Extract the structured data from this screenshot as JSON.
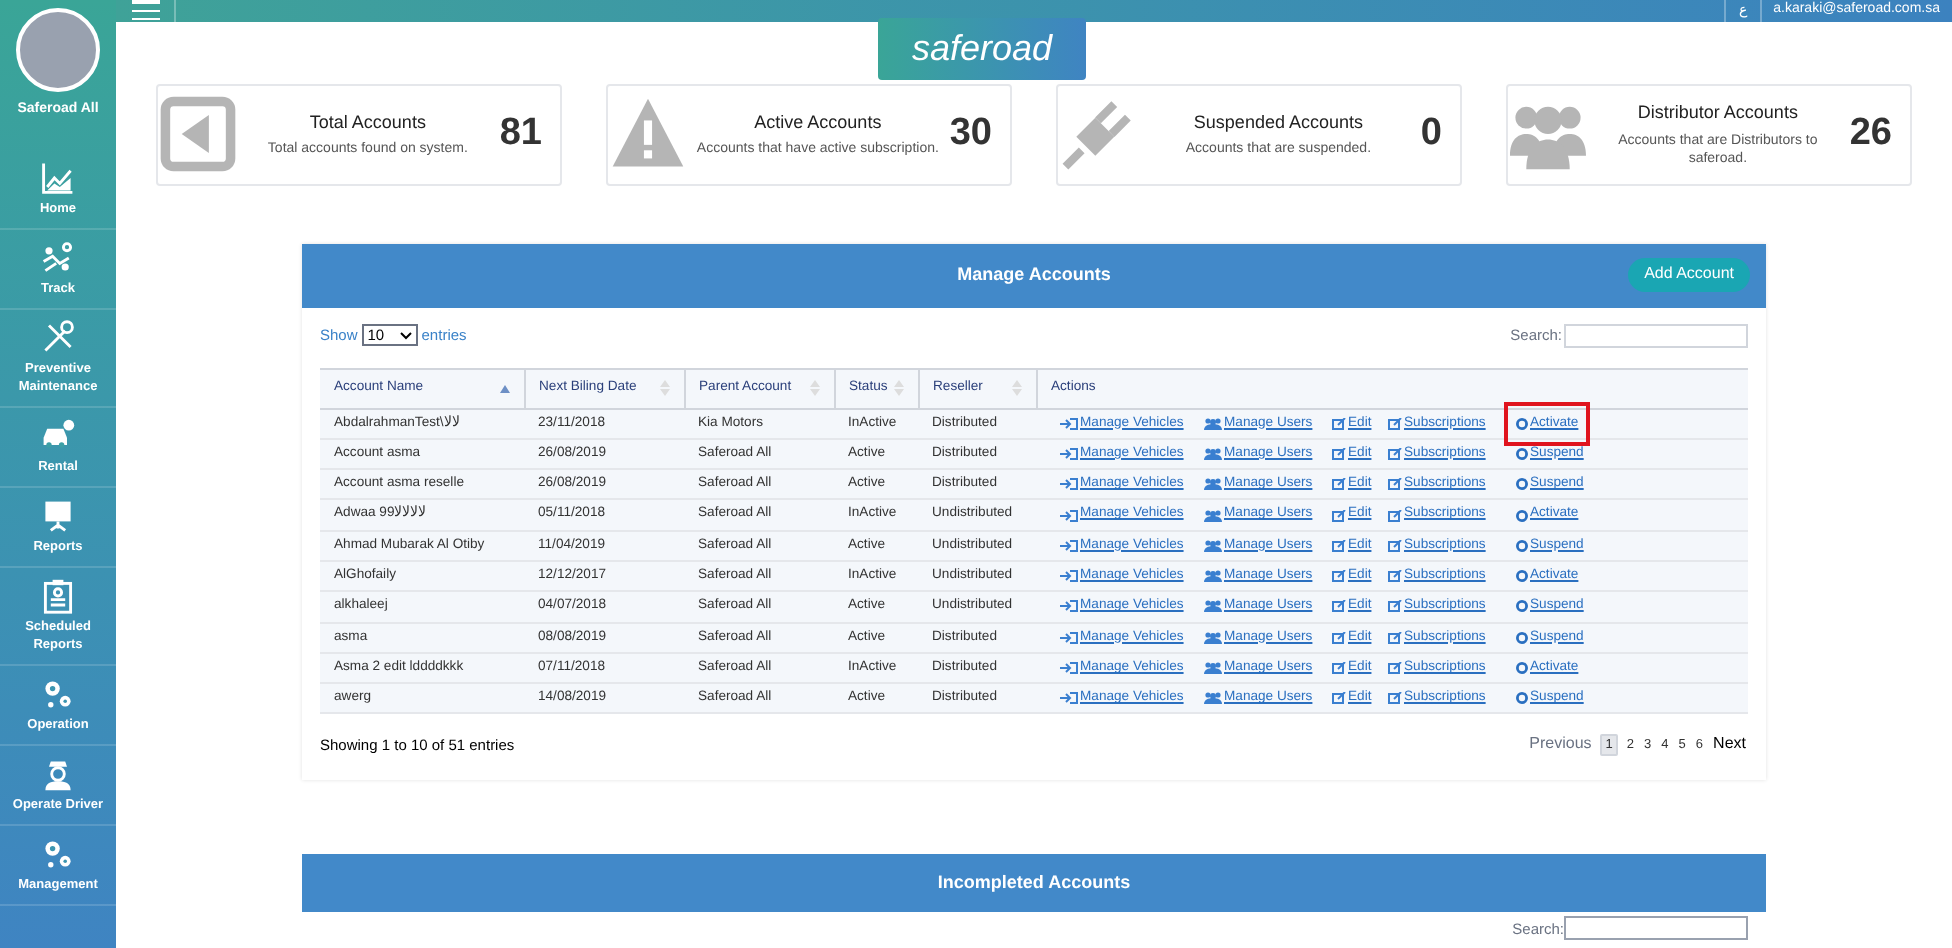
{
  "sidebar": {
    "user": "Saferoad All",
    "items": [
      {
        "label": "Home",
        "kind": "chart"
      },
      {
        "label": "Track",
        "kind": "track"
      },
      {
        "label": "Preventive Maintenance",
        "kind": "tools"
      },
      {
        "label": "Rental",
        "kind": "car"
      },
      {
        "label": "Reports",
        "kind": "board"
      },
      {
        "label": "Scheduled Reports",
        "kind": "clipboard"
      },
      {
        "label": "Operation",
        "kind": "gears"
      },
      {
        "label": "Operate Driver",
        "kind": "driver"
      },
      {
        "label": "Management",
        "kind": "gears"
      }
    ]
  },
  "topbar": {
    "language": "ع",
    "email": "a.karaki@saferoad.com.sa",
    "logo": "saferoad"
  },
  "stats": [
    {
      "title": "Total Accounts",
      "description": "Total accounts found on system.",
      "value": "81",
      "kind": "back"
    },
    {
      "title": "Active Accounts",
      "description": "Accounts that have active subscription.",
      "value": "30",
      "kind": "warning"
    },
    {
      "title": "Suspended Accounts",
      "description": "Accounts that are suspended.",
      "value": "0",
      "kind": "plug"
    },
    {
      "title": "Distributor Accounts",
      "description": "Accounts that are Distributors to saferoad.",
      "value": "26",
      "kind": "users"
    }
  ],
  "manage_accounts": {
    "title": "Manage Accounts",
    "add_button": "Add Account",
    "show_label": "Show",
    "page_size": "10",
    "entries_label": "entries",
    "search_label": "Search:",
    "columns": [
      "Account Name",
      "Next Biling Date",
      "Parent Account",
      "Status",
      "Reseller",
      "Actions"
    ],
    "rows": [
      {
        "cells": [
          "AbdalrahmanTest\\ﻻﻻ",
          "23/11/2018",
          "Kia Motors",
          "InActive",
          "Distributed"
        ],
        "actions": [
          "Manage Vehicles",
          "Manage Users",
          "Edit",
          "Subscriptions",
          "Activate"
        ],
        "highlighted": true
      },
      {
        "cells": [
          "Account asma",
          "26/08/2019",
          "Saferoad All",
          "Active",
          "Distributed"
        ],
        "actions": [
          "Manage Vehicles",
          "Manage Users",
          "Edit",
          "Subscriptions",
          "Suspend"
        ],
        "highlighted": false
      },
      {
        "cells": [
          "Account asma reselle",
          "26/08/2019",
          "Saferoad All",
          "Active",
          "Distributed"
        ],
        "actions": [
          "Manage Vehicles",
          "Manage Users",
          "Edit",
          "Subscriptions",
          "Suspend"
        ],
        "highlighted": false
      },
      {
        "cells": [
          "Adwaa 99ﻻﻻﻻﻻ",
          "05/11/2018",
          "Saferoad All",
          "InActive",
          "Undistributed"
        ],
        "actions": [
          "Manage Vehicles",
          "Manage Users",
          "Edit",
          "Subscriptions",
          "Activate"
        ],
        "highlighted": false
      },
      {
        "cells": [
          "Ahmad Mubarak Al Otiby",
          "11/04/2019",
          "Saferoad All",
          "Active",
          "Undistributed"
        ],
        "actions": [
          "Manage Vehicles",
          "Manage Users",
          "Edit",
          "Subscriptions",
          "Suspend"
        ],
        "highlighted": false
      },
      {
        "cells": [
          "AlGhofaily",
          "12/12/2017",
          "Saferoad All",
          "InActive",
          "Undistributed"
        ],
        "actions": [
          "Manage Vehicles",
          "Manage Users",
          "Edit",
          "Subscriptions",
          "Activate"
        ],
        "highlighted": false
      },
      {
        "cells": [
          "alkhaleej",
          "04/07/2018",
          "Saferoad All",
          "Active",
          "Undistributed"
        ],
        "actions": [
          "Manage Vehicles",
          "Manage Users",
          "Edit",
          "Subscriptions",
          "Suspend"
        ],
        "highlighted": false
      },
      {
        "cells": [
          "asma",
          "08/08/2019",
          "Saferoad All",
          "Active",
          "Distributed"
        ],
        "actions": [
          "Manage Vehicles",
          "Manage Users",
          "Edit",
          "Subscriptions",
          "Suspend"
        ],
        "highlighted": false
      },
      {
        "cells": [
          "Asma 2 edit lddddkkk",
          "07/11/2018",
          "Saferoad All",
          "InActive",
          "Distributed"
        ],
        "actions": [
          "Manage Vehicles",
          "Manage Users",
          "Edit",
          "Subscriptions",
          "Activate"
        ],
        "highlighted": false
      },
      {
        "cells": [
          "awerg",
          "14/08/2019",
          "Saferoad All",
          "Active",
          "Distributed"
        ],
        "actions": [
          "Manage Vehicles",
          "Manage Users",
          "Edit",
          "Subscriptions",
          "Suspend"
        ],
        "highlighted": false
      }
    ],
    "summary": "Showing 1 to 10 of 51 entries",
    "pagination": [
      {
        "label": "Previous",
        "selected": false
      },
      {
        "label": "1",
        "selected": true
      },
      {
        "label": "2",
        "selected": false
      },
      {
        "label": "3",
        "selected": false
      },
      {
        "label": "4",
        "selected": false
      },
      {
        "label": "5",
        "selected": false
      },
      {
        "label": "6",
        "selected": false
      },
      {
        "label": "Next",
        "selected": false
      }
    ]
  },
  "incompleted_accounts": {
    "title": "Incompleted Accounts",
    "search_label": "Search:"
  }
}
